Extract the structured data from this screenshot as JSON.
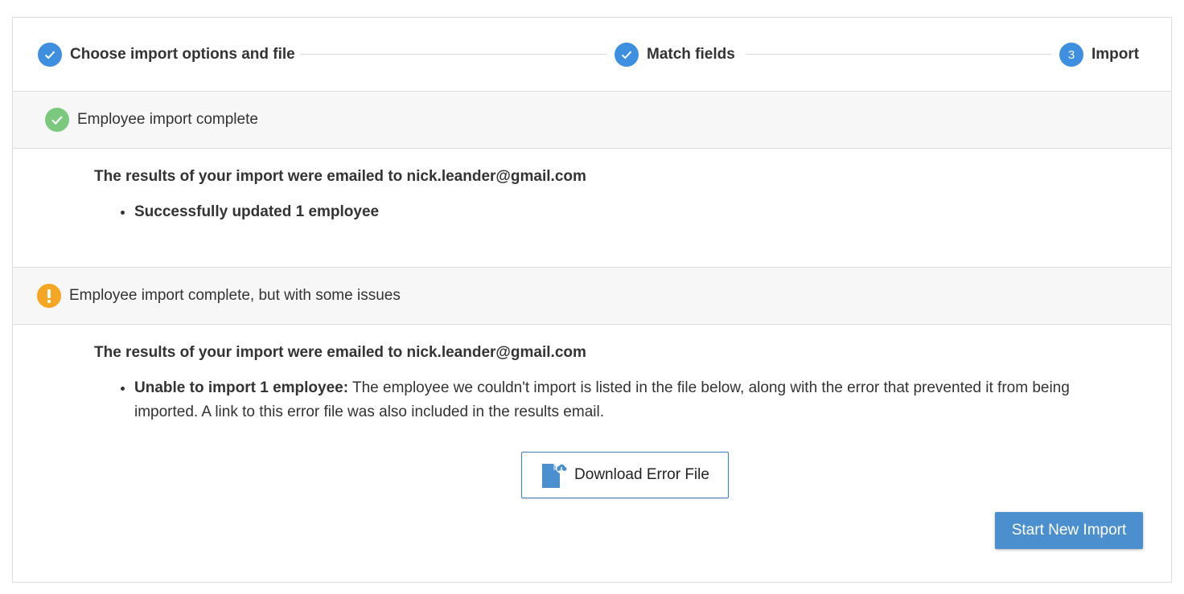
{
  "stepper": {
    "steps": [
      {
        "label": "Choose import options and file",
        "state": "complete"
      },
      {
        "label": "Match fields",
        "state": "complete"
      },
      {
        "label": "Import",
        "number": "3",
        "state": "active"
      }
    ]
  },
  "success_section": {
    "header": "Employee import complete",
    "icon": "check-circle-icon",
    "icon_color": "#7bc97f",
    "heading": "The results of your import were emailed to nick.leander@gmail.com",
    "items": [
      {
        "bold": "Successfully updated 1 employee",
        "text": ""
      }
    ]
  },
  "warning_section": {
    "header": "Employee import complete, but with some issues",
    "icon": "exclamation-icon",
    "icon_color": "#f5a623",
    "heading": "The results of your import were emailed to nick.leander@gmail.com",
    "items": [
      {
        "bold": "Unable to import 1 employee:",
        "text": " The employee we couldn't import is listed in the file below, along with the error that prevented it from being imported. A link to this error file was also included in the results email."
      }
    ],
    "download_label": "Download Error File"
  },
  "actions": {
    "start_new_import_label": "Start New Import"
  },
  "colors": {
    "accent": "#3f8fe0",
    "primary_button": "#4b8fce"
  }
}
